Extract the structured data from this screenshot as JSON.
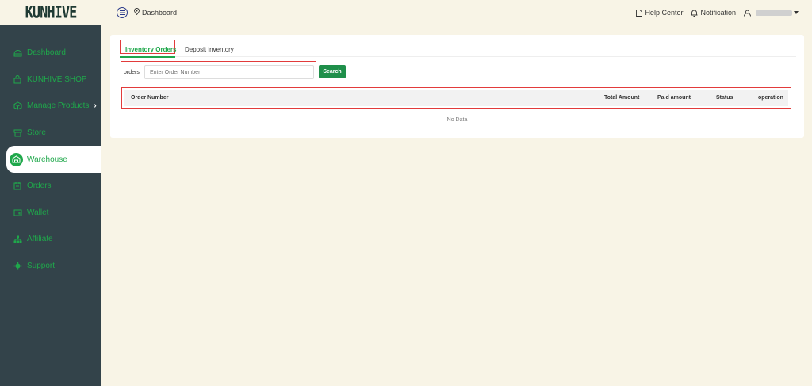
{
  "brand": {
    "logo_text": "KUNHIVE",
    "logo_sub": "— ⚬ —"
  },
  "sidebar": {
    "items": [
      {
        "label": "Dashboard",
        "icon": "dashboard-icon"
      },
      {
        "label": "KUNHIVE SHOP",
        "icon": "shop-icon"
      },
      {
        "label": "Manage Products",
        "icon": "box-icon",
        "chevron": "›"
      },
      {
        "label": "Store",
        "icon": "store-icon"
      },
      {
        "label": "Warehouse",
        "icon": "warehouse-icon",
        "active": true
      },
      {
        "label": "Orders",
        "icon": "orders-icon"
      },
      {
        "label": "Wallet",
        "icon": "wallet-icon"
      },
      {
        "label": "Affiliate",
        "icon": "affiliate-icon"
      },
      {
        "label": "Support",
        "icon": "support-icon"
      }
    ]
  },
  "topbar": {
    "breadcrumb": "Dashboard",
    "help": "Help Center",
    "notification": "Notification"
  },
  "tabs": [
    {
      "label": "Inventory Orders",
      "active": true
    },
    {
      "label": "Deposit inventory"
    }
  ],
  "search": {
    "label": "orders",
    "placeholder": "Enter Order Number",
    "button": "Search"
  },
  "table": {
    "columns": [
      "Order Number",
      "Total Amount",
      "Paid amount",
      "Status",
      "operation"
    ],
    "empty": "No Data"
  },
  "colors": {
    "accent": "#1fa84b",
    "sidebar": "#33434a",
    "background": "#f8f4e6",
    "highlight": "#e23b3b"
  }
}
